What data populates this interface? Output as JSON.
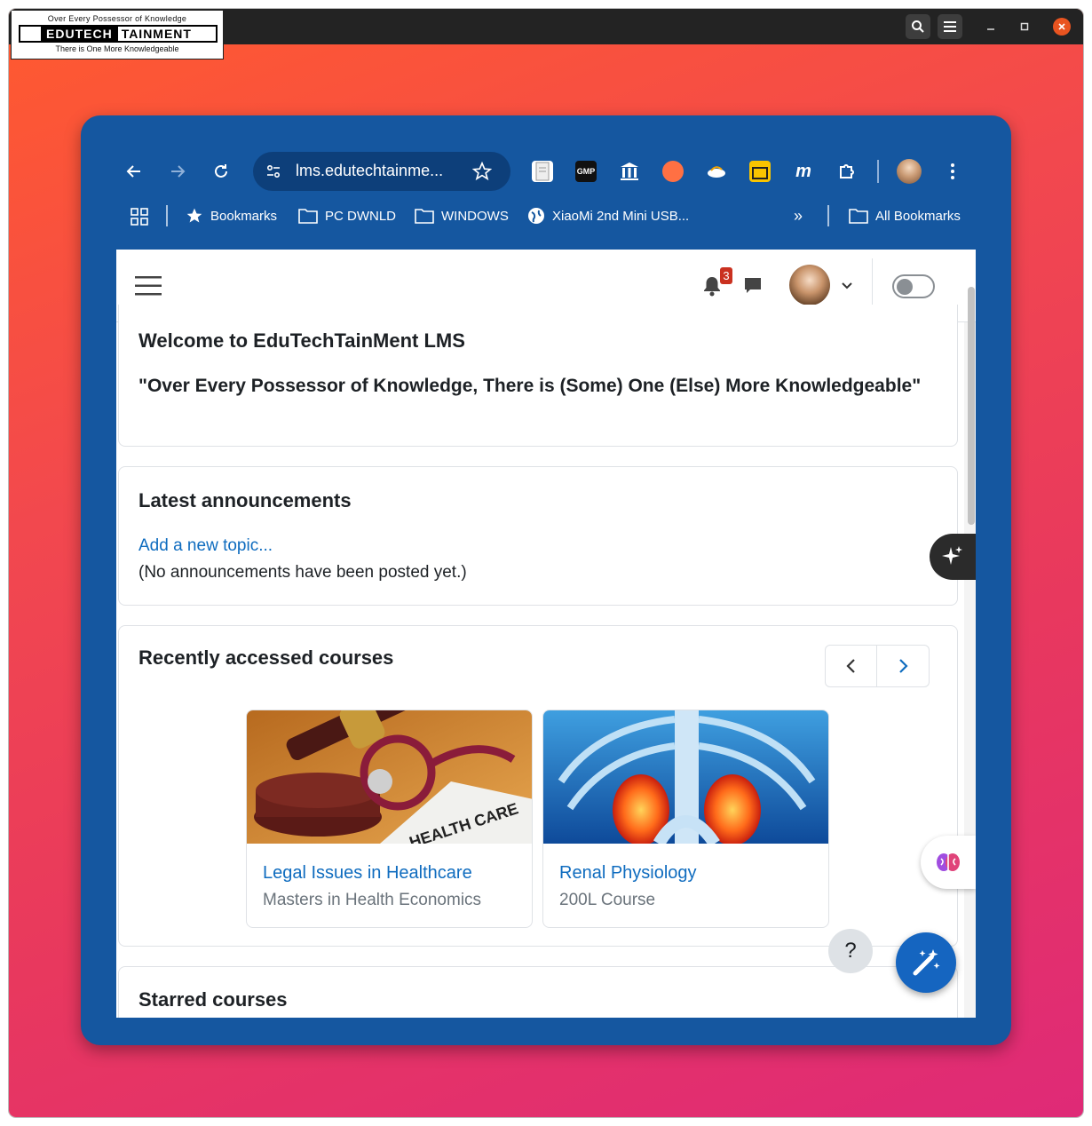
{
  "logo": {
    "top_line": "Over Every Possessor of Knowledge",
    "word_a": "EDUTECH",
    "word_b": "TAINMENT",
    "bottom_line": "There is One More Knowledgeable"
  },
  "browser": {
    "url": "lms.edutechtainme...",
    "extensions": [
      {
        "name": "file-icon"
      },
      {
        "name": "gmp-icon",
        "label": "GMP"
      },
      {
        "name": "bank-icon"
      },
      {
        "name": "orange-app-icon"
      },
      {
        "name": "download-icon"
      },
      {
        "name": "wallet-icon"
      },
      {
        "name": "m-icon"
      },
      {
        "name": "puzzle-icon"
      }
    ],
    "bookmarks": [
      {
        "label": "Bookmarks",
        "icon": "star-icon"
      },
      {
        "label": "PC DWNLD",
        "icon": "folder-icon"
      },
      {
        "label": "WINDOWS",
        "icon": "folder-icon"
      },
      {
        "label": "XiaoMi 2nd Mini USB...",
        "icon": "globe-icon"
      }
    ],
    "more_bookmarks": "»",
    "all_bookmarks": "All Bookmarks"
  },
  "navbar": {
    "notification_count": "3"
  },
  "welcome": {
    "title": "Welcome to EduTechTainMent LMS",
    "quote": "\"Over Every Possessor of Knowledge, There is (Some) One (Else) More Knowledgeable\""
  },
  "announcements": {
    "title": "Latest announcements",
    "add_link": "Add a new topic...",
    "empty_text": "(No announcements have been posted yet.)"
  },
  "recent_courses": {
    "title": "Recently accessed courses",
    "courses": [
      {
        "name": "Legal Issues in Healthcare",
        "category": "Masters in Health Economics"
      },
      {
        "name": "Renal Physiology",
        "category": "200L Course"
      }
    ]
  },
  "starred": {
    "title": "Starred courses"
  },
  "help_button": "?",
  "colors": {
    "browser_frame": "#1557a0",
    "link": "#0f6cbf",
    "fab": "#1565c0",
    "badge": "#ca3120"
  }
}
